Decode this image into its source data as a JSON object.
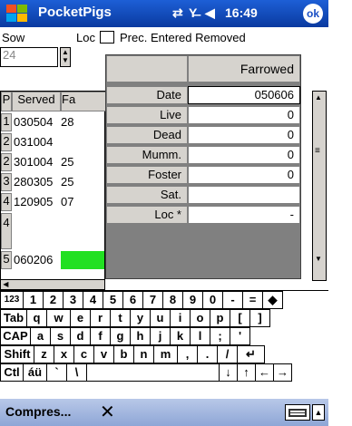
{
  "titlebar": {
    "app_name": "PocketPigs",
    "clock": "16:49",
    "ok_label": "ok"
  },
  "form": {
    "sow_label": "Sow",
    "sow_value": "24",
    "loc_label": "Loc",
    "header_partial": "Prec. Entered Removed"
  },
  "grid": {
    "columns": [
      "P",
      "Served",
      "Fa"
    ],
    "rows": [
      {
        "p": "1",
        "served": "030504",
        "fa": "28"
      },
      {
        "p": "2",
        "served": "031004",
        "fa": ""
      },
      {
        "p": "2",
        "served": "301004",
        "fa": "25"
      },
      {
        "p": "3",
        "served": "280305",
        "fa": "25"
      },
      {
        "p": "4",
        "served": "120905",
        "fa": "07"
      },
      {
        "p": "4",
        "served": "",
        "fa": ""
      },
      {
        "p": "5",
        "served": "060206",
        "fa": ""
      }
    ],
    "highlight_color": "#22e022"
  },
  "popup": {
    "header": "Farrowed",
    "fields": [
      {
        "label": "Date",
        "value": "050606"
      },
      {
        "label": "Live",
        "value": "0"
      },
      {
        "label": "Dead",
        "value": "0"
      },
      {
        "label": "Mumm.",
        "value": "0"
      },
      {
        "label": "Foster",
        "value": "0"
      },
      {
        "label": "Sat.",
        "value": ""
      },
      {
        "label": "Loc *",
        "value": "-"
      }
    ]
  },
  "keyboard": {
    "rows": [
      [
        "123",
        "1",
        "2",
        "3",
        "4",
        "5",
        "6",
        "7",
        "8",
        "9",
        "0",
        "-",
        "=",
        "◆"
      ],
      [
        "Tab",
        "q",
        "w",
        "e",
        "r",
        "t",
        "y",
        "u",
        "i",
        "o",
        "p",
        "[",
        "]"
      ],
      [
        "CAP",
        "a",
        "s",
        "d",
        "f",
        "g",
        "h",
        "j",
        "k",
        "l",
        ";",
        "'"
      ],
      [
        "Shift",
        "z",
        "x",
        "c",
        "v",
        "b",
        "n",
        "m",
        ",",
        ".",
        "/",
        "↵"
      ],
      [
        "Ctl",
        "áü",
        "`",
        "\\",
        "",
        "↓",
        "↑",
        "←",
        "→"
      ]
    ]
  },
  "bottombar": {
    "menu_label": "Compres..."
  },
  "icons": {
    "start": "windows-flag-icon",
    "connectivity": "arrows-icon",
    "signal": "no-signal-icon",
    "volume": "speaker-icon",
    "close": "x-icon",
    "keyboard": "keyboard-icon",
    "sip_arrow": "up-arrow-icon"
  }
}
